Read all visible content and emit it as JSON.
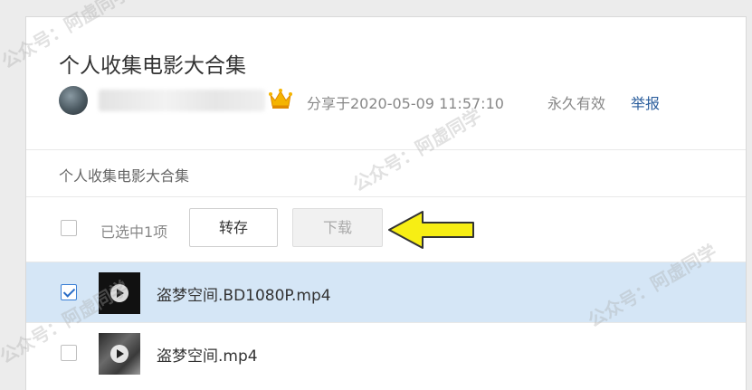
{
  "share": {
    "title": "个人收集电影大合集",
    "username": "",
    "share_time": "分享于2020-05-09 11:57:10",
    "validity": "永久有效",
    "report_label": "举报"
  },
  "breadcrumb": "个人收集电影大合集",
  "toolbar": {
    "selected_count": "已选中1项",
    "save_label": "转存",
    "download_label": "下载"
  },
  "files": [
    {
      "name": "盗梦空间.BD1080P.mp4",
      "selected": true
    },
    {
      "name": "盗梦空间.mp4",
      "selected": false
    }
  ],
  "watermark": "公众号：阿虚同学",
  "colors": {
    "selected_row": "#d5e6f6",
    "link": "#2a5d9c",
    "arrow": "#f7ee14"
  },
  "icons": {
    "crown": "crown-icon",
    "arrow": "arrow-left-icon",
    "play": "play-icon"
  }
}
